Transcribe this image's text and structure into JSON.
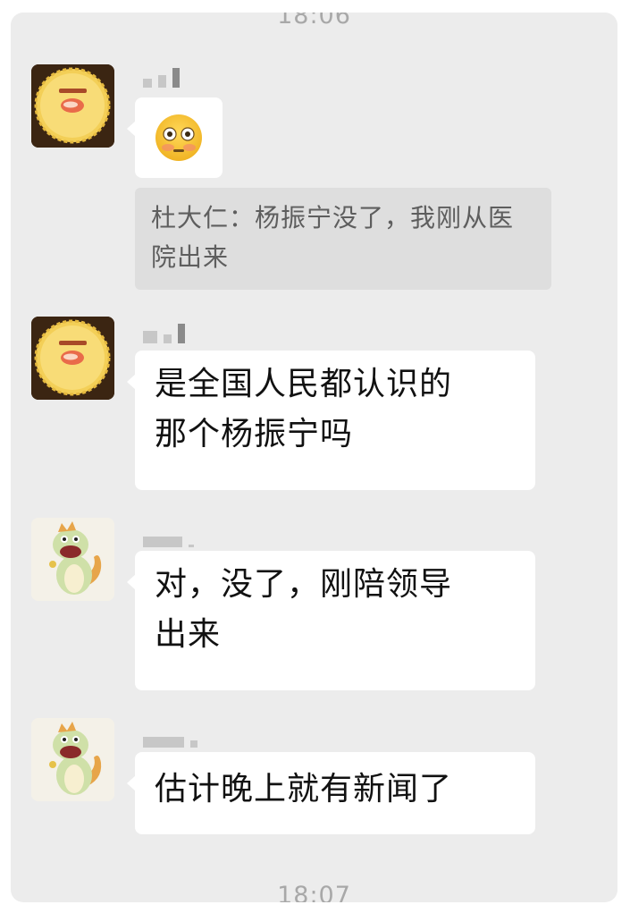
{
  "chat": {
    "time_top": "18:06",
    "time_bottom": "18:07",
    "messages": [
      {
        "text": "😳",
        "quote": "杜大仁：杨振宁没了，我刚从医院出来"
      },
      {
        "text": "是全国人民都认识的\n那个杨振宁吗"
      },
      {
        "text": "对，没了，刚陪领导\n出来"
      },
      {
        "text": "估计晚上就有新闻了"
      }
    ]
  },
  "colors": {
    "background": "#ececec",
    "bubble": "#ffffff",
    "quote_bg": "#dedede",
    "quote_text": "#5e5e5e",
    "timestamp": "#a8a8a8"
  },
  "icons": {
    "avatar_a": "rice-cracker-avatar-icon",
    "avatar_b": "cartoon-dragon-avatar-icon",
    "emoji": "flushed-face-emoji"
  }
}
